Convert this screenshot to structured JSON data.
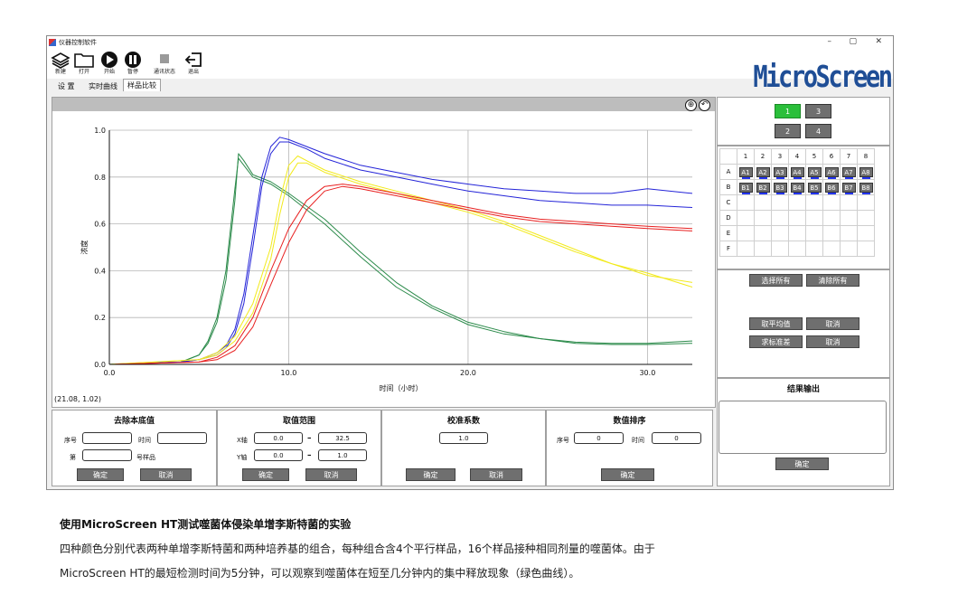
{
  "window": {
    "title": "仪器控制软件",
    "controls": [
      "–",
      "▢",
      "✕"
    ]
  },
  "toolbar": [
    {
      "label": "新建",
      "icon": "new-stack-icon"
    },
    {
      "label": "打开",
      "icon": "folder-icon"
    },
    {
      "label": "开始",
      "icon": "play-icon"
    },
    {
      "label": "暂停",
      "icon": "pause-icon"
    },
    {
      "label": "通讯状态",
      "icon": "comm-status-icon"
    },
    {
      "label": "退出",
      "icon": "exit-icon"
    }
  ],
  "logo": "MicroScreen",
  "tabs": [
    "设 置",
    "实时曲线",
    "样品比较"
  ],
  "chart": {
    "zoom_in": "⊕",
    "back": "↶",
    "coord_readout": "(21.08, 1.02)"
  },
  "chart_data": {
    "type": "line",
    "xlabel": "时间（小时）",
    "ylabel": "浓度",
    "xlim": [
      0,
      32.5
    ],
    "ylim": [
      0,
      1.0
    ],
    "xticks": [
      "0.0",
      "10.0",
      "20.0",
      "30.0"
    ],
    "yticks": [
      "0.0",
      "0.2",
      "0.4",
      "0.6",
      "0.8",
      "1.0"
    ],
    "grid": true,
    "series": [
      {
        "color": "#2b8a4a",
        "x": [
          0,
          4,
          5,
          5.5,
          6,
          6.5,
          7,
          7.2,
          7.5,
          8,
          9,
          10,
          12,
          14,
          16,
          18,
          20,
          22,
          24,
          26,
          28,
          30,
          32.5
        ],
        "y": [
          0,
          0.01,
          0.04,
          0.1,
          0.2,
          0.4,
          0.75,
          0.88,
          0.85,
          0.8,
          0.77,
          0.72,
          0.6,
          0.46,
          0.33,
          0.24,
          0.17,
          0.13,
          0.11,
          0.09,
          0.085,
          0.085,
          0.09
        ]
      },
      {
        "color": "#2b8a4a",
        "x": [
          0,
          4,
          5,
          5.5,
          6,
          6.5,
          7,
          7.2,
          7.5,
          8,
          9,
          10,
          12,
          14,
          16,
          18,
          20,
          22,
          24,
          26,
          28,
          30,
          32.5
        ],
        "y": [
          0,
          0.01,
          0.04,
          0.09,
          0.18,
          0.36,
          0.7,
          0.9,
          0.87,
          0.81,
          0.78,
          0.73,
          0.62,
          0.48,
          0.35,
          0.25,
          0.18,
          0.14,
          0.11,
          0.095,
          0.09,
          0.09,
          0.1
        ]
      },
      {
        "color": "#2424d8",
        "x": [
          0,
          4,
          5,
          6,
          6.5,
          7,
          7.5,
          8,
          8.5,
          9,
          9.5,
          10,
          11,
          12,
          14,
          16,
          18,
          20,
          22,
          24,
          26,
          28,
          30,
          32.5
        ],
        "y": [
          0,
          0.01,
          0.02,
          0.05,
          0.08,
          0.15,
          0.3,
          0.55,
          0.8,
          0.93,
          0.97,
          0.96,
          0.93,
          0.9,
          0.85,
          0.82,
          0.79,
          0.77,
          0.75,
          0.74,
          0.73,
          0.73,
          0.75,
          0.73
        ]
      },
      {
        "color": "#2424d8",
        "x": [
          0,
          4,
          5,
          6,
          6.5,
          7,
          7.5,
          8,
          8.5,
          9,
          9.5,
          10,
          11,
          12,
          14,
          16,
          18,
          20,
          22,
          24,
          26,
          28,
          30,
          32.5
        ],
        "y": [
          0,
          0.01,
          0.02,
          0.04,
          0.07,
          0.13,
          0.26,
          0.5,
          0.76,
          0.9,
          0.95,
          0.95,
          0.92,
          0.88,
          0.83,
          0.8,
          0.77,
          0.74,
          0.72,
          0.7,
          0.69,
          0.68,
          0.68,
          0.67
        ]
      },
      {
        "color": "#f2ea1c",
        "x": [
          0,
          5,
          6,
          7,
          8,
          9,
          9.5,
          10,
          10.5,
          11,
          12,
          14,
          16,
          18,
          20,
          22,
          24,
          26,
          28,
          30,
          32.5
        ],
        "y": [
          0,
          0.02,
          0.05,
          0.12,
          0.26,
          0.5,
          0.7,
          0.85,
          0.89,
          0.87,
          0.83,
          0.78,
          0.74,
          0.7,
          0.66,
          0.61,
          0.55,
          0.49,
          0.43,
          0.39,
          0.33
        ]
      },
      {
        "color": "#f2ea1c",
        "x": [
          0,
          5,
          6,
          7,
          8,
          9,
          9.5,
          10,
          10.5,
          11,
          12,
          14,
          16,
          18,
          20,
          22,
          24,
          26,
          28,
          30,
          32.5
        ],
        "y": [
          0,
          0.02,
          0.04,
          0.1,
          0.22,
          0.45,
          0.64,
          0.8,
          0.86,
          0.86,
          0.82,
          0.77,
          0.73,
          0.69,
          0.65,
          0.6,
          0.54,
          0.48,
          0.43,
          0.38,
          0.35
        ]
      },
      {
        "color": "#e82020",
        "x": [
          0,
          5,
          6,
          7,
          8,
          9,
          10,
          11,
          12,
          13,
          14,
          16,
          18,
          20,
          22,
          24,
          26,
          28,
          30,
          32.5
        ],
        "y": [
          0,
          0.01,
          0.03,
          0.08,
          0.2,
          0.4,
          0.58,
          0.7,
          0.76,
          0.77,
          0.76,
          0.73,
          0.7,
          0.67,
          0.64,
          0.62,
          0.61,
          0.6,
          0.59,
          0.58
        ]
      },
      {
        "color": "#e82020",
        "x": [
          0,
          5,
          6,
          7,
          8,
          9,
          10,
          11,
          12,
          13,
          14,
          16,
          18,
          20,
          22,
          24,
          26,
          28,
          30,
          32.5
        ],
        "y": [
          0,
          0.01,
          0.02,
          0.06,
          0.16,
          0.34,
          0.52,
          0.66,
          0.74,
          0.76,
          0.75,
          0.72,
          0.69,
          0.66,
          0.63,
          0.61,
          0.6,
          0.59,
          0.58,
          0.57
        ]
      }
    ]
  },
  "panels": {
    "subtract_base": {
      "title": "去除本底值",
      "seq_label": "序号",
      "time_label": "时间",
      "nth_label": "第",
      "sample_label": "号样品",
      "ok": "确定",
      "cancel": "取消"
    },
    "range": {
      "title": "取值范围",
      "x_label": "X轴",
      "y_label": "Y轴",
      "x_min": "0.0",
      "x_max": "32.5",
      "y_min": "0.0",
      "y_max": "1.0",
      "dash": "–",
      "ok": "确定",
      "cancel": "取消"
    },
    "calibration": {
      "title": "校准系数",
      "value": "1.0",
      "ok": "确定",
      "cancel": "取消"
    },
    "sort": {
      "title": "数值排序",
      "seq_label": "序号",
      "seq_value": "0",
      "time_label": "时间",
      "time_value": "0",
      "ok": "确定"
    }
  },
  "group_buttons": [
    {
      "label": "1",
      "active": true
    },
    {
      "label": "3",
      "active": false
    },
    {
      "label": "2",
      "active": false
    },
    {
      "label": "4",
      "active": false
    }
  ],
  "plate": {
    "columns": [
      "1",
      "2",
      "3",
      "4",
      "5",
      "6",
      "7",
      "8"
    ],
    "rows": [
      "A",
      "B",
      "C",
      "D",
      "E",
      "F"
    ],
    "wells": {
      "A": [
        "A1",
        "A2",
        "A3",
        "A4",
        "A5",
        "A6",
        "A7",
        "A8"
      ],
      "B": [
        "B1",
        "B2",
        "B3",
        "B4",
        "B5",
        "B6",
        "B7",
        "B8"
      ]
    }
  },
  "selection": {
    "select_all": "选择所有",
    "clear_all": "清除所有",
    "average": "取平均值",
    "average_cancel": "取消",
    "std_dev": "求标准差",
    "std_cancel": "取消"
  },
  "result": {
    "title": "结果输出",
    "ok": "确定"
  },
  "caption": {
    "heading": "使用MicroScreen HT测试噬菌体侵染单增李斯特菌的实验",
    "line1": "四种颜色分别代表两种单增李斯特菌和两种培养基的组合，每种组合含4个平行样品，16个样品接种相同剂量的噬菌体。由于",
    "line2": "MicroScreen HT的最短检测时间为5分钟，可以观察到噬菌体在短至几分钟内的集中释放现象（绿色曲线）。"
  }
}
